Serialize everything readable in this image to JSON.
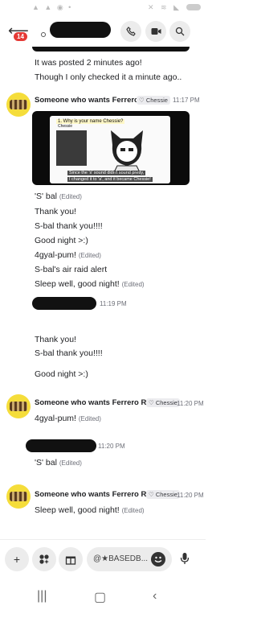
{
  "header": {
    "badge": "14"
  },
  "messages": {
    "top_line1": "It was posted 2 minutes ago!",
    "top_line2": "Though I only checked it a minute ago..",
    "m1": {
      "author": "Someone who wants Ferrero Rocher",
      "tag": "Chessie",
      "time": "11:17 PM",
      "image_caption": "1. Why is your name Chessie?",
      "image_label": "Chessie",
      "image_sub1": "Since the 's' sound didn't sound pretty,",
      "image_sub2": "I changed it to 'a', and it became Chessie!",
      "l1": "'S' bal",
      "l1_edited": "(Edited)",
      "l2": "Thank you!",
      "l3": "S-bal thank you!!!!",
      "l4": "Good night >:)",
      "l5": "4gyal-pum!",
      "l5_edited": "(Edited)",
      "l6": "S-bal's air raid alert",
      "l7": "Sleep well, good night!",
      "l7_edited": "(Edited)"
    },
    "m2": {
      "time": "11:19 PM",
      "l1": "Thank you!",
      "l2": "S-bal thank you!!!!",
      "l3": "Good night >:)"
    },
    "m3": {
      "author": "Someone who wants Ferrero Rocher",
      "tag": "Chessie",
      "time": "11:20 PM",
      "l1": "4gyal-pum!",
      "l1_edited": "(Edited)"
    },
    "m4": {
      "time": "11:20 PM",
      "l1": "'S' bal",
      "l1_edited": "(Edited)"
    },
    "m5": {
      "author": "Someone who wants Ferrero Rocher",
      "tag": "Chessie",
      "time": "11:20 PM",
      "l1": "Sleep well, good night!",
      "l1_edited": "(Edited)"
    }
  },
  "composer": {
    "placeholder": "@★BASEDB..."
  },
  "icons": {
    "back": "arrow-left-icon",
    "call": "phone-icon",
    "video": "video-icon",
    "search": "search-icon",
    "add": "plus-icon",
    "apps": "apps-icon",
    "gift": "gift-icon",
    "emoji": "emoji-icon",
    "mic": "mic-icon"
  }
}
